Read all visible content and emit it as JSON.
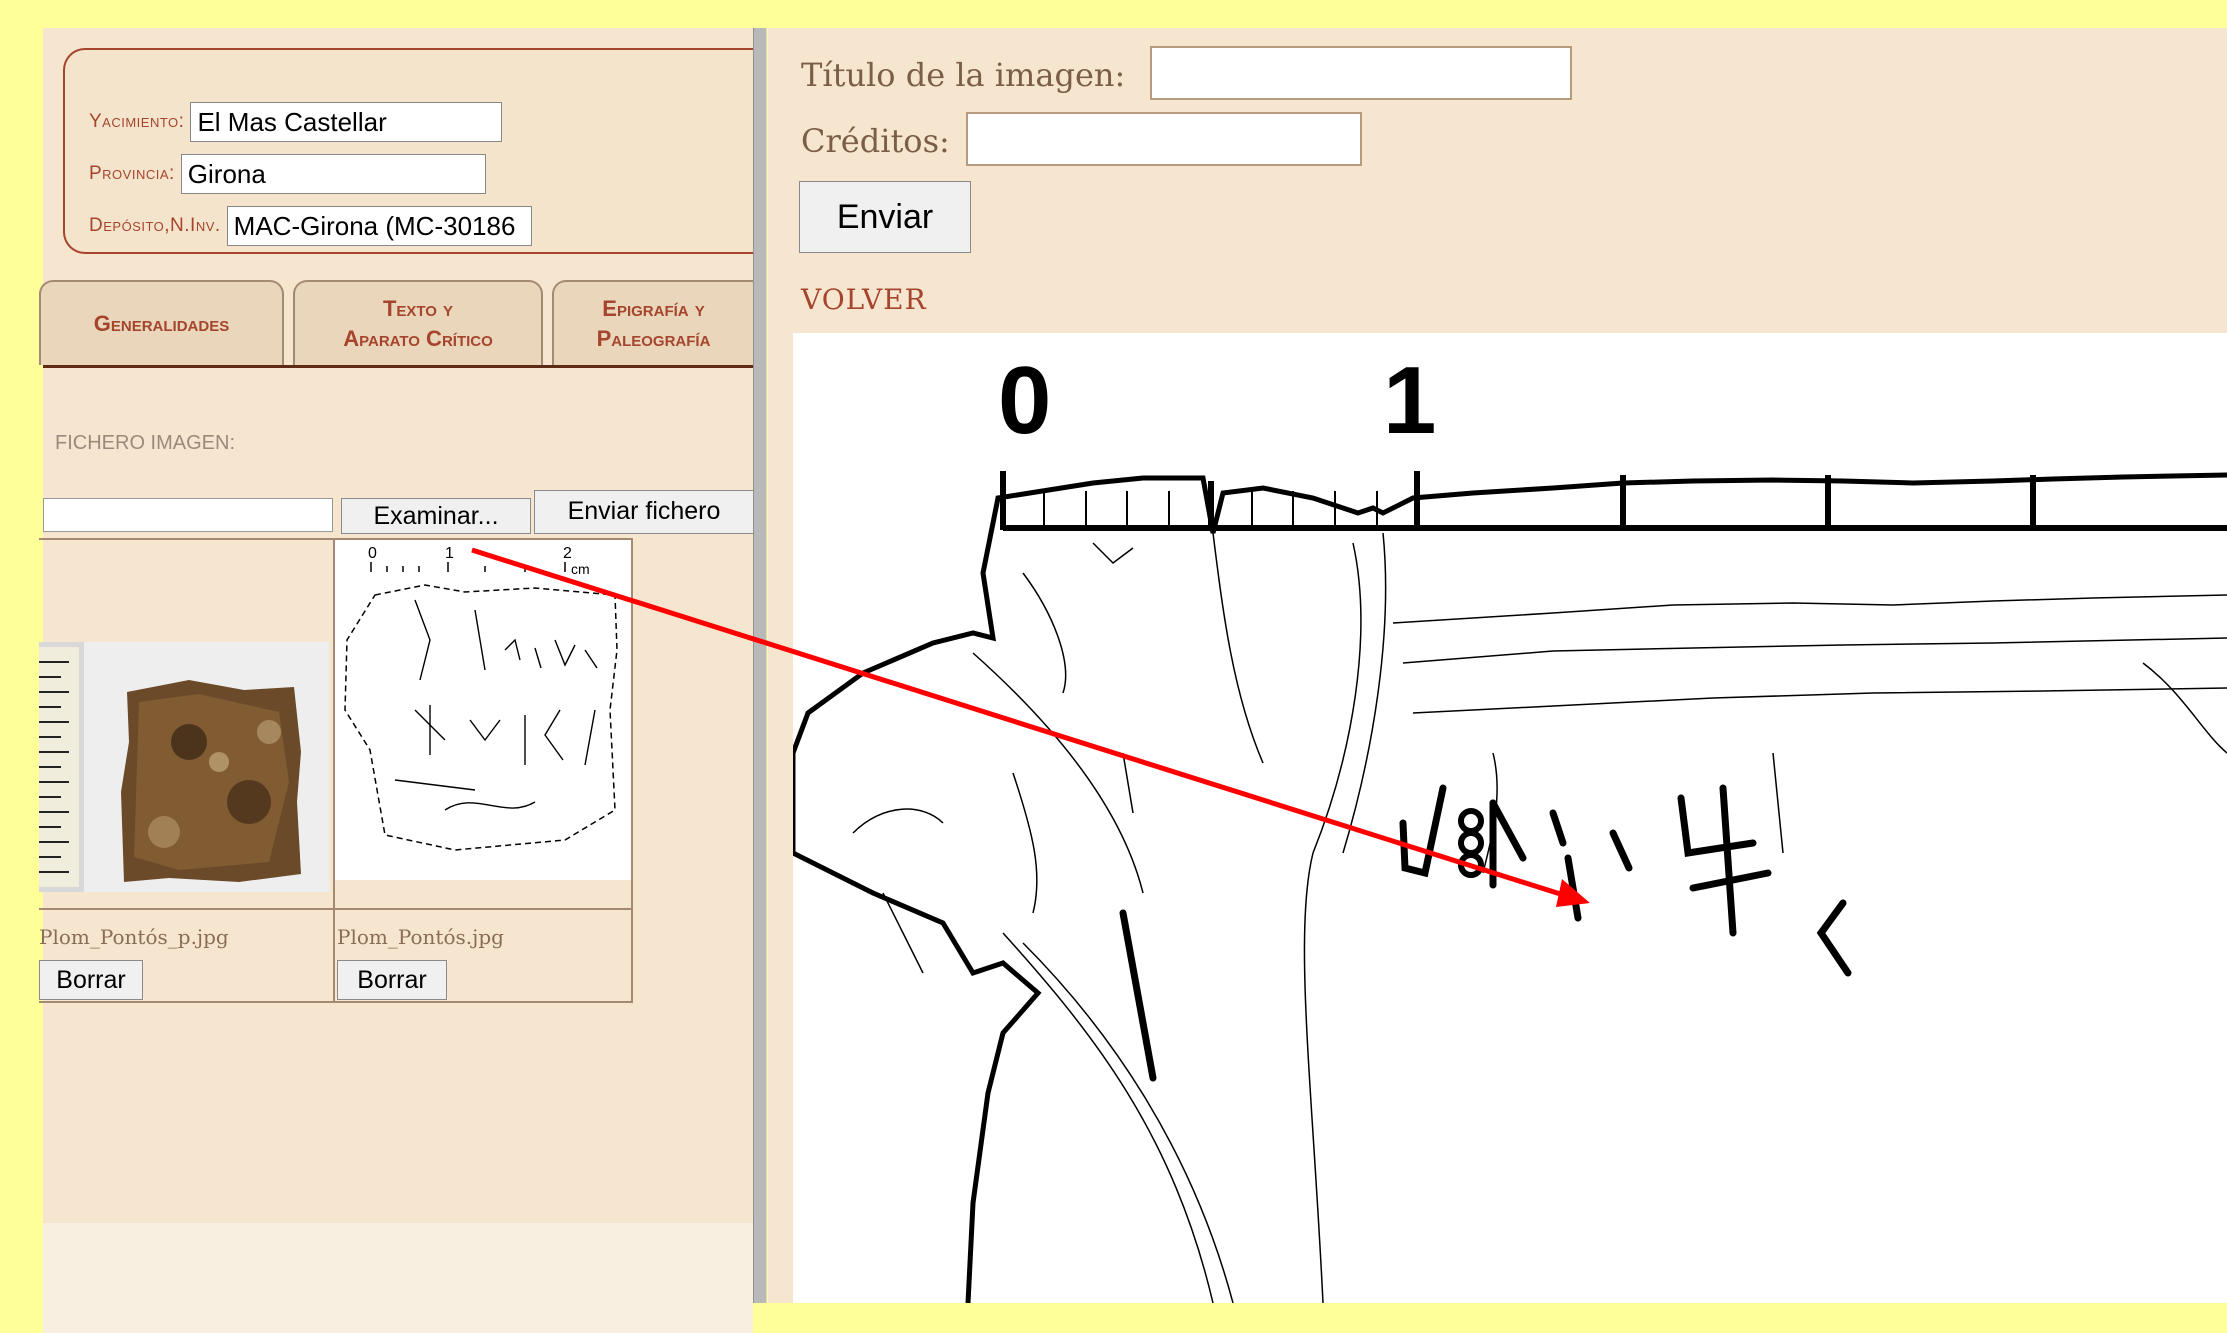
{
  "metadata": {
    "yacimiento_label": "Yacimiento:",
    "yacimiento_value": "El Mas Castellar",
    "provincia_label": "Provincia:",
    "provincia_value": "Girona",
    "deposito_label": "Depósito,N.Inv.",
    "deposito_value": "MAC-Girona (MC-30186"
  },
  "tabs": [
    {
      "line1": "",
      "line2": "Generalidades"
    },
    {
      "line1": "Texto y",
      "line2": "Aparato Crítico"
    },
    {
      "line1": "Epigrafía y",
      "line2": "Paleografía"
    }
  ],
  "upload": {
    "label": "FICHERO IMAGEN:",
    "browse_button": "Examinar...",
    "send_button": "Enviar fichero"
  },
  "images": [
    {
      "filename": "Plom_Pontós_p.jpg",
      "delete_button": "Borrar"
    },
    {
      "filename": "Plom_Pontós.jpg",
      "delete_button": "Borrar"
    }
  ],
  "thumb_scale": {
    "labels": [
      "0",
      "1",
      "2"
    ],
    "unit": "cm"
  },
  "form": {
    "title_label": "Título de la imagen:",
    "title_value": "",
    "credits_label": "Créditos:",
    "credits_value": "",
    "submit_button": "Enviar",
    "back_link": "VOLVER"
  },
  "viewer_scale": {
    "labels": [
      "0",
      "1"
    ]
  },
  "colors": {
    "outer_background": "#ffff99",
    "panel_background": "#f6e6cf",
    "accent": "#a5452e",
    "arrow": "#ff0000"
  }
}
